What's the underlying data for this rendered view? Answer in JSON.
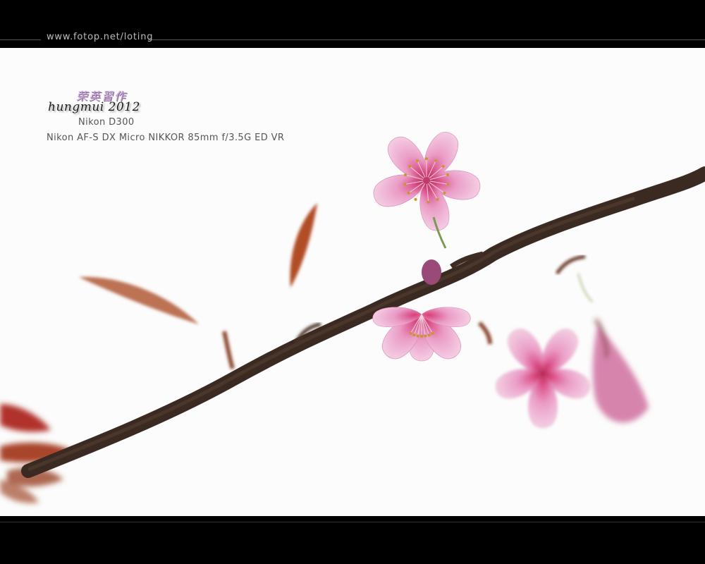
{
  "header": {
    "site_url": "www.fotop.net/loting"
  },
  "watermark": {
    "cjk_signature": "荣英習作",
    "author_signature": "hungmui 2012"
  },
  "exif": {
    "camera": "Nikon D300",
    "lens": "Nikon AF-S DX Micro NIKKOR 85mm f/3.5G ED VR"
  },
  "colors": {
    "frame": "#000000",
    "background": "#fcfcfc",
    "branch": "#3a2a22",
    "petal": "#e7a2c8",
    "petal_center": "#d0306a",
    "leaf": "#b5502c"
  }
}
